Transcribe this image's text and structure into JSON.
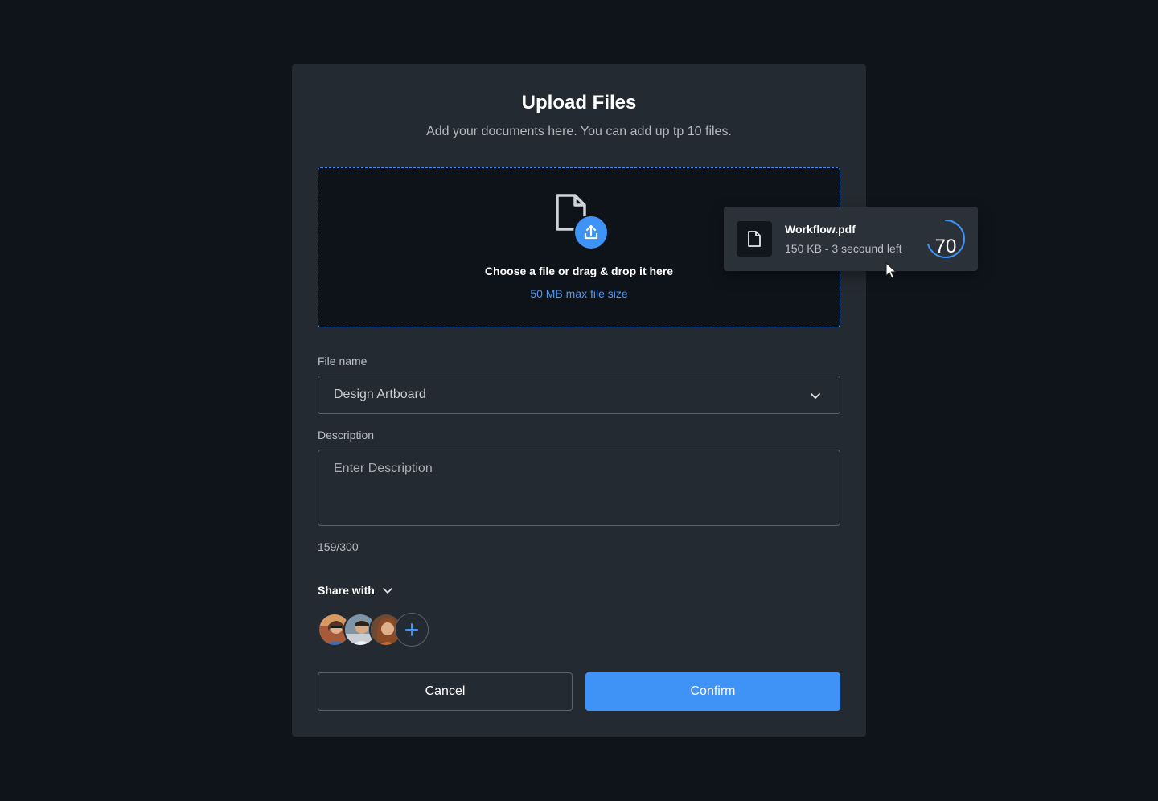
{
  "modal": {
    "title": "Upload Files",
    "subtitle": "Add your documents here. You can add up tp 10 files."
  },
  "dropzone": {
    "icon": "file-upload-icon",
    "title": "Choose a file or drag & drop it here",
    "hint": "50 MB max file size"
  },
  "form": {
    "file_name_label": "File name",
    "file_name_value": "Design Artboard",
    "description_label": "Description",
    "description_placeholder": "Enter Description",
    "counter": "159/300",
    "share_label": "Share with"
  },
  "share": {
    "avatars": [
      "avatar-1",
      "avatar-2",
      "avatar-3"
    ],
    "add_icon": "plus-icon"
  },
  "buttons": {
    "cancel": "Cancel",
    "confirm": "Confirm"
  },
  "upload_toast": {
    "file_name": "Workflow.pdf",
    "meta": "150 KB - 3 secound left",
    "progress": "70",
    "progress_fraction": 0.7
  },
  "colors": {
    "background": "#0f141b",
    "modal": "#242a31",
    "accent": "#3f93f7",
    "dropzone_border": "#3f8ef5"
  }
}
